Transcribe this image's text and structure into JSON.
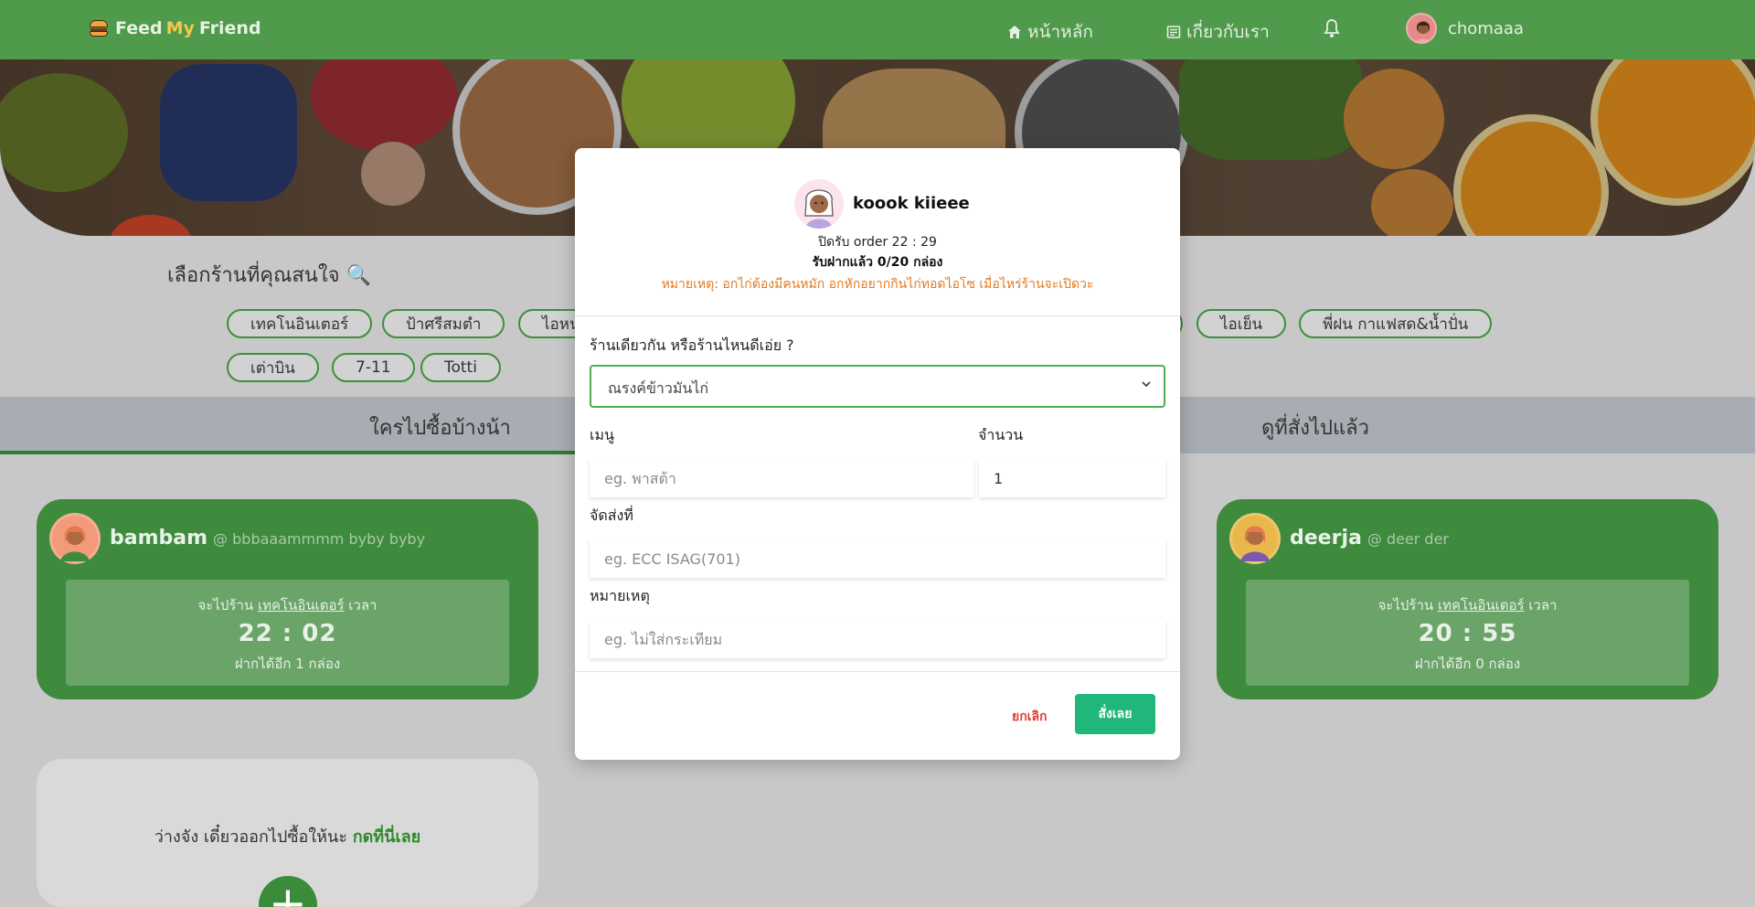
{
  "nav": {
    "brand_feed": "Feed",
    "brand_my": "My",
    "brand_friend": "Friend",
    "home": "หน้าหลัก",
    "about": "เกี่ยวกับเรา",
    "user": "chomaaa",
    "icons": {
      "logo": "burger-icon",
      "home": "home-icon",
      "about": "news-icon",
      "bell": "bell-icon"
    }
  },
  "choose": {
    "title": "เลือกร้านที่คุณสนใจ 🔍",
    "chips": [
      "เทคโนอินเตอร์",
      "ป้าศรีสมตำ",
      "ไอหน",
      "ไอเย็น",
      "พี่ฝน กาแฟสด&น้ำปั่น",
      "เต่าบิน",
      "7-11",
      "Totti"
    ]
  },
  "tabs": {
    "left": "ใครไปซื้อบ้างน้า",
    "right": "ดูที่สั่งไปแล้ว"
  },
  "cards": [
    {
      "name": "bambam",
      "handle": "@ bbbaaammmm byby byby",
      "goto": "จะไปร้าน",
      "shop": "เทคโนอินเตอร์",
      "at": "เวลา",
      "time": "22 : 02",
      "remaining": "ฝากได้อีก 1 กล่อง"
    },
    {
      "name": "deerja",
      "handle": "@ deer der",
      "goto": "จะไปร้าน",
      "shop": "เทคโนอินเตอร์",
      "at": "เวลา",
      "time": "20 : 55",
      "remaining": "ฝากได้อีก 0 กล่อง"
    }
  ],
  "empty": {
    "text": "ว่างจัง เดี๋ยวออกไปซื้อให้นะ ",
    "link": "กดที่นี่เลย",
    "plus": "+"
  },
  "modal": {
    "name": "koook kiieee",
    "close_time": "ปิดรับ order 22 : 29",
    "received": "รับฝากแล้ว 0/20 กล่อง",
    "note": "หมายเหตุ: อกไก่ต้องมีคนหมัก อกหักอยากกินไก่ทอดไอโซ เมื่อไหร่ร้านจะเปิดวะ",
    "shop_label": "ร้านเดียวกัน หรือร้านไหนดีเอ่ย ?",
    "shop_value": "ณรงค์ข้าวมันไก่",
    "menu_label": "เมนู",
    "menu_placeholder": "eg. พาสต้า",
    "qty_label": "จำนวน",
    "qty_value": "1",
    "deliver_label": "จัดส่งที่",
    "deliver_placeholder": "eg. ECC ISAG(701)",
    "remark_label": "หมายเหตุ",
    "remark_placeholder": "eg. ไม่ใส่กระเทียม",
    "cancel": "ยกเลิก",
    "order": "สั่งเลย"
  },
  "colors": {
    "nav": "#4f9a4b",
    "card": "#3f8b3e",
    "order_button": "#20b77b",
    "note": "#e57a1f",
    "cancel": "#e53935"
  }
}
